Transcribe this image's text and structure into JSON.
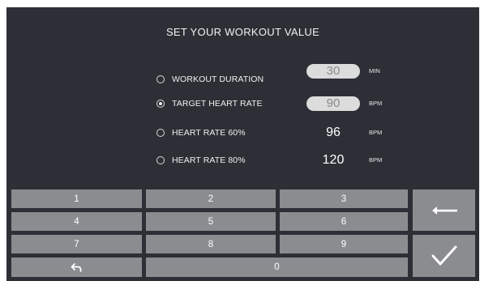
{
  "screen": {
    "title": "SET YOUR WORKOUT VALUE",
    "options": [
      {
        "label": "WORKOUT DURATION",
        "value": "30",
        "unit": "MIN",
        "selected": false,
        "editable": true
      },
      {
        "label": "TARGET HEART RATE",
        "value": "90",
        "unit": "BPM",
        "selected": true,
        "editable": true
      },
      {
        "label": "HEART RATE 60%",
        "value": "96",
        "unit": "BPM",
        "selected": false,
        "editable": false
      },
      {
        "label": "HEART RATE 80%",
        "value": "120",
        "unit": "BPM",
        "selected": false,
        "editable": false
      }
    ]
  },
  "keypad": {
    "digits": [
      "1",
      "2",
      "3",
      "4",
      "5",
      "6",
      "7",
      "8",
      "9",
      "0"
    ],
    "undo_icon": "undo-arrow-icon",
    "backspace_icon": "left-arrow-icon",
    "confirm_icon": "checkmark-icon"
  },
  "colors": {
    "background": "#2c3036",
    "key": "#8a8c90",
    "pill": "#dcdcdc"
  }
}
